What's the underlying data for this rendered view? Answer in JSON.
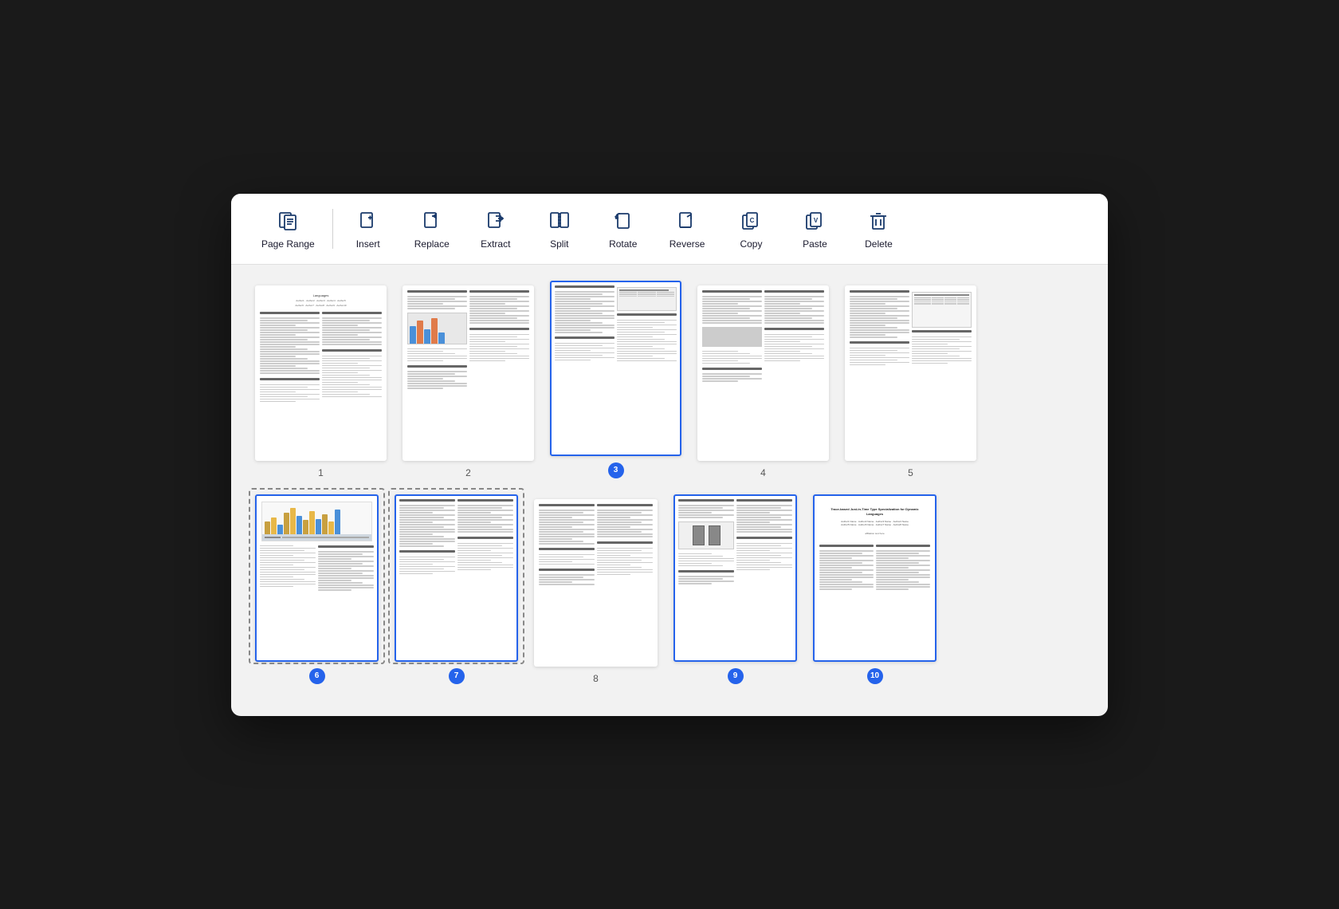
{
  "toolbar": {
    "items": [
      {
        "id": "page-range",
        "label": "Page Range",
        "icon": "page-range-icon"
      },
      {
        "id": "insert",
        "label": "Insert",
        "icon": "insert-icon"
      },
      {
        "id": "replace",
        "label": "Replace",
        "icon": "replace-icon"
      },
      {
        "id": "extract",
        "label": "Extract",
        "icon": "extract-icon"
      },
      {
        "id": "split",
        "label": "Split",
        "icon": "split-icon"
      },
      {
        "id": "rotate",
        "label": "Rotate",
        "icon": "rotate-icon"
      },
      {
        "id": "reverse",
        "label": "Reverse",
        "icon": "reverse-icon"
      },
      {
        "id": "copy",
        "label": "Copy",
        "icon": "copy-icon"
      },
      {
        "id": "paste",
        "label": "Paste",
        "icon": "paste-icon"
      },
      {
        "id": "delete",
        "label": "Delete",
        "icon": "delete-icon"
      }
    ]
  },
  "pages": {
    "row1": [
      {
        "num": "1",
        "badge": false,
        "selected": false,
        "dashed": false
      },
      {
        "num": "2",
        "badge": false,
        "selected": false,
        "dashed": false
      },
      {
        "num": "3",
        "badge": true,
        "selected": true,
        "dashed": false
      },
      {
        "num": "4",
        "badge": false,
        "selected": false,
        "dashed": false
      },
      {
        "num": "5",
        "badge": false,
        "selected": false,
        "dashed": false
      }
    ],
    "row2": [
      {
        "num": "6",
        "badge": true,
        "selected": true,
        "dashed": true,
        "hasChart": true
      },
      {
        "num": "7",
        "badge": true,
        "selected": true,
        "dashed": true
      },
      {
        "num": "8",
        "badge": false,
        "selected": false,
        "dashed": false
      },
      {
        "num": "9",
        "badge": true,
        "selected": true,
        "dashed": false,
        "hasFigure": true
      },
      {
        "num": "10",
        "badge": true,
        "selected": true,
        "dashed": false,
        "isTitle": true
      }
    ]
  }
}
